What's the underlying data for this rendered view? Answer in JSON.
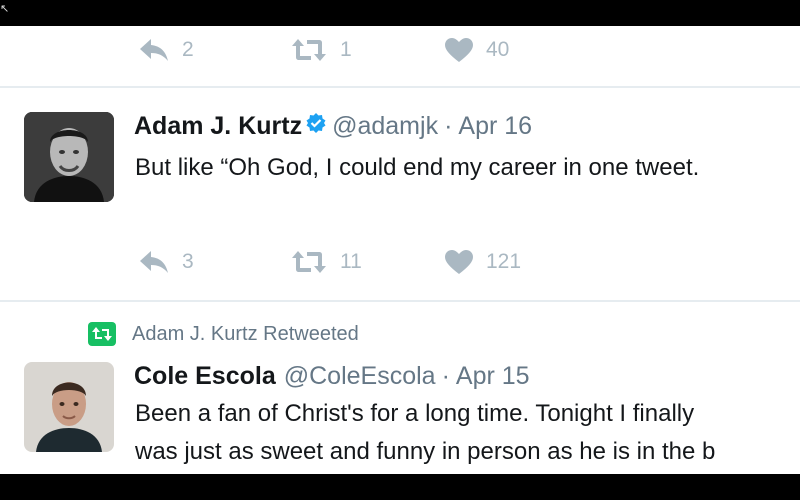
{
  "tweets": [
    {
      "stats": {
        "replies": "2",
        "retweets": "1",
        "likes": "40"
      }
    },
    {
      "author_name": "Adam J. Kurtz",
      "handle": "@adamjk",
      "separator": "·",
      "date": "Apr 16",
      "text": "But like “Oh God, I could end my career in one tweet.",
      "stats": {
        "replies": "3",
        "retweets": "11",
        "likes": "121"
      }
    },
    {
      "retweeted_by": "Adam J. Kurtz Retweeted",
      "author_name": "Cole Escola",
      "handle": "@ColeEscola",
      "separator": "·",
      "date": "Apr 15",
      "text_line1": "Been a fan of Christ's for a long time. Tonight I finally",
      "text_line2": "was just as sweet and funny in person as he is in the b"
    }
  ],
  "icons": {
    "reply": "reply-icon",
    "retweet": "retweet-icon",
    "like": "heart-icon",
    "verified": "verified-badge-icon",
    "retweeted": "retweeted-icon"
  },
  "colors": {
    "action_gray": "#aab8c2",
    "verified_blue": "#1da1f2",
    "retweet_green": "#17bf63"
  }
}
